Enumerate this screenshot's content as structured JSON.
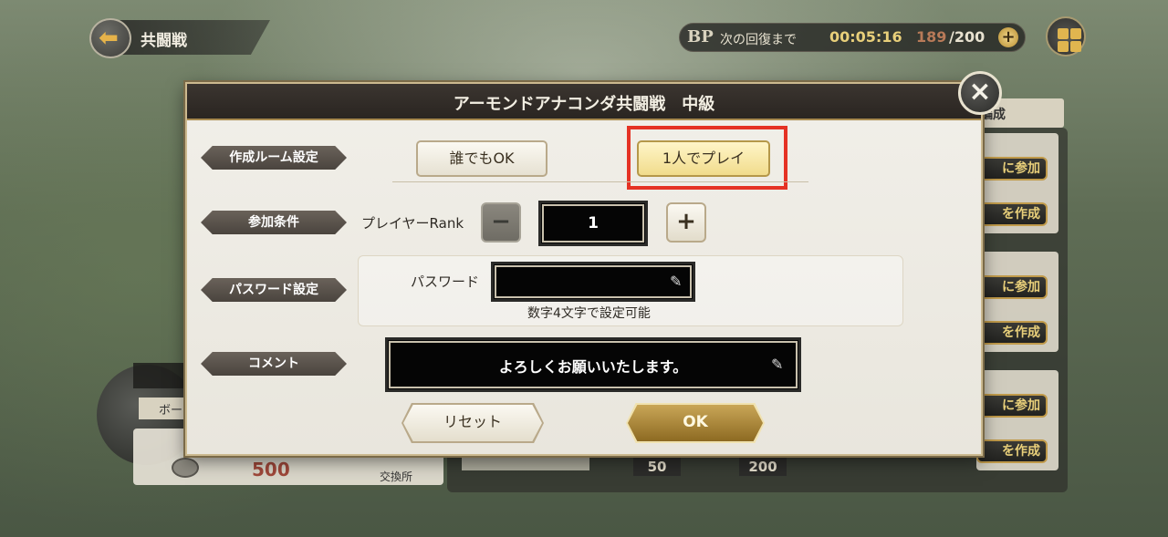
{
  "header": {
    "back_title": "共闘戦",
    "bp_label": "BP",
    "bp_next_label": "次の回復まで",
    "bp_timer": "00:05:16",
    "bp_current": "189",
    "bp_max": "/200",
    "bp_plus": "+"
  },
  "background": {
    "tab_label": "編成",
    "join_labels": [
      "に参加",
      "を作成",
      "に参加",
      "を作成",
      "に参加",
      "を作成"
    ],
    "left_value": "500",
    "left_shop": "交換所",
    "left_tag": "ボー",
    "bottom_numbers": [
      "50",
      "200"
    ]
  },
  "modal": {
    "title": "アーモンドアナコンダ共闘戦　中級",
    "close_icon": "×",
    "room_setting_label": "作成ルーム設定",
    "room_options": [
      "誰でもOK",
      "1人でプレイ"
    ],
    "selected_option": "1人でプレイ",
    "condition_label": "参加条件",
    "player_rank_label": "プレイヤーRank",
    "rank_value": "1",
    "minus": "−",
    "plus": "+",
    "password_section_label": "パスワード設定",
    "password_label": "パスワード",
    "password_value": "",
    "password_hint": "数字4文字で設定可能",
    "comment_label": "コメント",
    "comment_value": "よろしくお願いいたします。",
    "reset_label": "リセット",
    "ok_label": "OK"
  },
  "colors": {
    "highlight": "#e53224",
    "gold": "#c9a657",
    "dark_header": "#2a2521"
  }
}
